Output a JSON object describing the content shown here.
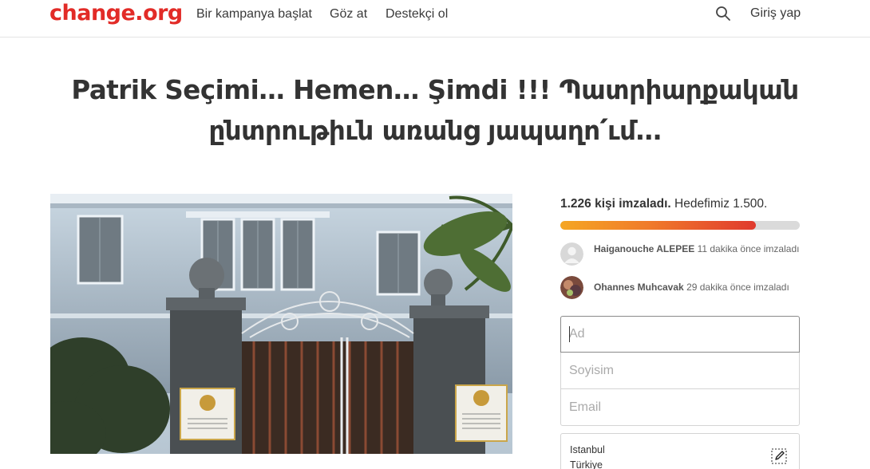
{
  "header": {
    "logo": "change.org",
    "nav": [
      "Bir kampanya başlat",
      "Göz at",
      "Destekçi ol"
    ],
    "search_icon": "search-icon",
    "login": "Giriş yap"
  },
  "colors": {
    "brand": "#e22b27",
    "progress_start": "#f5a623",
    "progress_end": "#e03a2e"
  },
  "petition": {
    "title": "Patrik Seçimi… Hemen… Şimdi !!! Պատրիարքական ընտրութիւն առանց յապաղո՛ւմ…",
    "image_alt": "Building with ornate iron gate"
  },
  "signatures": {
    "count_bold": "1.226 kişi imzaladı.",
    "goal_text": "Hedefimiz 1.500.",
    "progress": 0.817
  },
  "recent_signers": [
    {
      "name": "Haiganouche ALEPEE",
      "time": "11 dakika önce imzaladı"
    },
    {
      "name": "Ohannes Muhcavak",
      "time": "29 dakika önce imzaladı"
    }
  ],
  "form": {
    "first_name_placeholder": "Ad",
    "last_name_placeholder": "Soyisim",
    "email_placeholder": "Email",
    "city": "Istanbul",
    "country": "Türkiye",
    "edit_icon": "pencil-icon"
  }
}
